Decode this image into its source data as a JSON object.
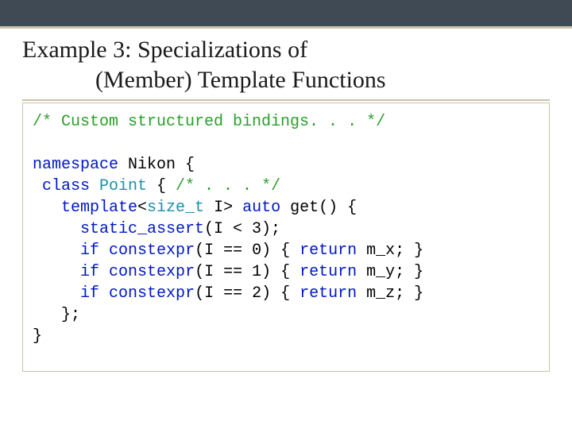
{
  "title": {
    "line1": "Example 3: Specializations of",
    "line2": "(Member) Template Functions"
  },
  "code": {
    "comment": "/* Custom structured bindings. . . */",
    "ns_kw": "namespace",
    "ns_name": " Nikon {",
    "class_kw": " class",
    "class_name": " Point",
    "class_tail": " { ",
    "class_inner_comment": "/* . . . */",
    "tpl_indent": "   ",
    "tpl_kw": "template",
    "tpl_open": "<",
    "size_t": "size_t",
    "tpl_rest": " I> ",
    "auto_kw": "auto",
    "get_call": " get() {",
    "sa_indent": "     ",
    "sa_kw": "static_assert",
    "sa_tail": "(I < 3);",
    "if_indent": "     ",
    "if_kw": "if",
    "space": " ",
    "constexpr_kw": "constexpr",
    "line_eq0": "(I == 0) { ",
    "return_kw": "return",
    "mx": " m_x; }",
    "line_eq1": "(I == 1) { ",
    "my": " m_y; }",
    "line_eq2": "(I == 2) { ",
    "mz": " m_z; }",
    "close_inner": "   };",
    "close_ns": "}"
  }
}
